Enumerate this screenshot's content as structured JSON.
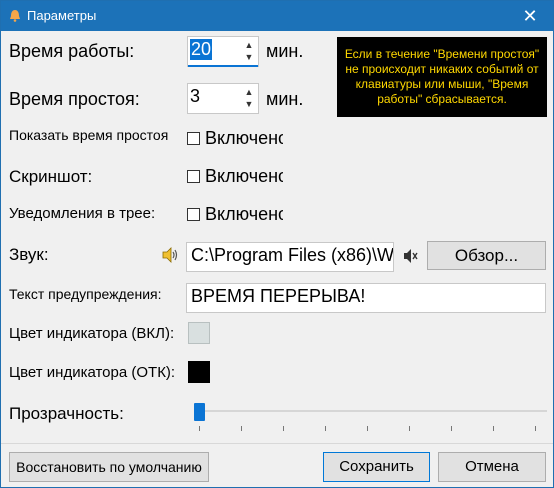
{
  "window": {
    "title": "Параметры",
    "close": "✕"
  },
  "work_time": {
    "label": "Время работы:",
    "value": "20",
    "unit": "мин."
  },
  "idle_time": {
    "label": "Время простоя:",
    "value": "3",
    "unit": "мин."
  },
  "tooltip": "Если в течение \"Времени простоя\" не происходит никаких событий от клавиатуры или мыши, \"Время работы\" сбрасывается.",
  "show_idle": {
    "label": "Показать время простоя",
    "checkbox_label": "Включено",
    "checked": false
  },
  "screenshot": {
    "label": "Скриншот:",
    "checkbox_label": "Включено",
    "checked": false
  },
  "tray_notify": {
    "label": "Уведомления в трее:",
    "checkbox_label": "Включено",
    "checked": false
  },
  "sound": {
    "label": "Звук:",
    "path": "C:\\Program Files (x86)\\W",
    "browse": "Обзор..."
  },
  "warning_text": {
    "label": "Текст предупреждения:",
    "value": "ВРЕМЯ ПЕРЕРЫВА!"
  },
  "indicator_on": {
    "label": "Цвет индикатора (ВКЛ):",
    "color": "#d9e0e0"
  },
  "indicator_off": {
    "label": "Цвет индикатора (ОТК):",
    "color": "#000000"
  },
  "transparency": {
    "label": "Прозрачность:",
    "value_percent": 0
  },
  "buttons": {
    "restore": "Восстановить по умолчанию",
    "save": "Сохранить",
    "cancel": "Отмена"
  },
  "colors": {
    "titlebar": "#1c72b8",
    "accent": "#0a74d4",
    "tooltip_bg": "#000000",
    "tooltip_fg": "#ffd800"
  }
}
